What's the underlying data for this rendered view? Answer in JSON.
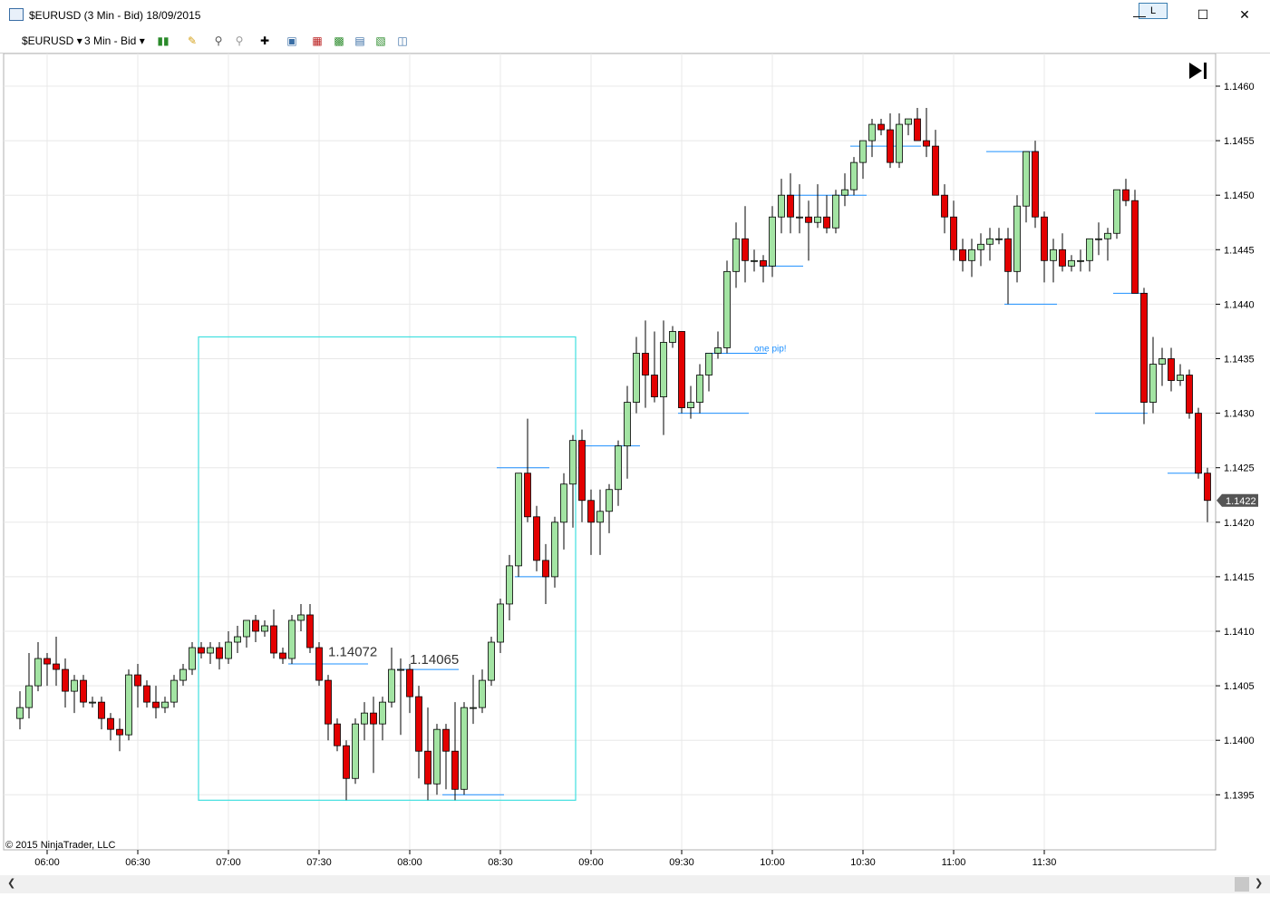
{
  "window": {
    "title": "$EURUSD (3 Min - Bid)  18/09/2015",
    "layout_button": "L",
    "minimize_icon": "minimize-icon",
    "maximize_icon": "maximize-icon",
    "close_icon": "close-icon"
  },
  "toolbar": {
    "instrument": "$EURUSD",
    "interval": "3 Min - Bid",
    "icons": [
      "chart-style-icon",
      "drawing-tool-icon",
      "zoom-in-icon",
      "zoom-out-icon",
      "crosshair-icon",
      "properties-icon",
      "strategies-icon",
      "indicators-icon",
      "chart-trader-icon",
      "data-box-icon",
      "panel-icon"
    ]
  },
  "colors": {
    "up": "#a3e4a3",
    "down": "#e30000",
    "level": "#1e90ff",
    "box": "#40e0e0",
    "grid": "#e8e8e8"
  },
  "chart_data": {
    "type": "candlestick",
    "copyright": "© 2015 NinjaTrader, LLC",
    "ylim": [
      1.1391,
      1.1462
    ],
    "y_ticks": [
      "1.1460",
      "1.1455",
      "1.1450",
      "1.1445",
      "1.1440",
      "1.1435",
      "1.1430",
      "1.1425",
      "1.1420",
      "1.1415",
      "1.1410",
      "1.1405",
      "1.1400",
      "1.1395"
    ],
    "x_ticks": [
      "06:00",
      "06:30",
      "07:00",
      "07:30",
      "08:00",
      "08:30",
      "09:00",
      "09:30",
      "10:00",
      "10:30",
      "11:00",
      "11:30"
    ],
    "start_time": "05:51",
    "bar_minutes": 3,
    "current_price": "1.1422",
    "annotations": {
      "price_label_1": "1.14072",
      "price_label_2": "1.14065",
      "note": "one pip!"
    },
    "ohlc": [
      [
        1.1402,
        1.14045,
        1.1401,
        1.1403
      ],
      [
        1.1403,
        1.1408,
        1.1402,
        1.1405
      ],
      [
        1.1405,
        1.1409,
        1.14045,
        1.14075
      ],
      [
        1.14075,
        1.1408,
        1.1405,
        1.1407
      ],
      [
        1.1407,
        1.14095,
        1.1405,
        1.14065
      ],
      [
        1.14065,
        1.14075,
        1.1403,
        1.14045
      ],
      [
        1.14045,
        1.1406,
        1.14025,
        1.14055
      ],
      [
        1.14055,
        1.1406,
        1.1403,
        1.14035
      ],
      [
        1.14035,
        1.1404,
        1.1403,
        1.14035
      ],
      [
        1.14035,
        1.1404,
        1.1401,
        1.1402
      ],
      [
        1.1402,
        1.14025,
        1.14,
        1.1401
      ],
      [
        1.1401,
        1.1402,
        1.1399,
        1.14005
      ],
      [
        1.14005,
        1.14065,
        1.14,
        1.1406
      ],
      [
        1.1406,
        1.1407,
        1.1403,
        1.1405
      ],
      [
        1.1405,
        1.14055,
        1.1403,
        1.14035
      ],
      [
        1.14035,
        1.1405,
        1.1402,
        1.1403
      ],
      [
        1.1403,
        1.1404,
        1.14025,
        1.14035
      ],
      [
        1.14035,
        1.1406,
        1.1403,
        1.14055
      ],
      [
        1.14055,
        1.1407,
        1.1405,
        1.14065
      ],
      [
        1.14065,
        1.1409,
        1.1406,
        1.14085
      ],
      [
        1.14085,
        1.1409,
        1.14075,
        1.1408
      ],
      [
        1.1408,
        1.1409,
        1.1407,
        1.14085
      ],
      [
        1.14085,
        1.1409,
        1.14065,
        1.14075
      ],
      [
        1.14075,
        1.141,
        1.1407,
        1.1409
      ],
      [
        1.1409,
        1.14105,
        1.1408,
        1.14095
      ],
      [
        1.14095,
        1.1411,
        1.14085,
        1.1411
      ],
      [
        1.1411,
        1.14115,
        1.1409,
        1.141
      ],
      [
        1.141,
        1.1411,
        1.14095,
        1.14105
      ],
      [
        1.14105,
        1.1412,
        1.14075,
        1.1408
      ],
      [
        1.1408,
        1.14085,
        1.1407,
        1.14075
      ],
      [
        1.14075,
        1.14115,
        1.1407,
        1.1411
      ],
      [
        1.1411,
        1.14125,
        1.141,
        1.14115
      ],
      [
        1.14115,
        1.14125,
        1.1408,
        1.14085
      ],
      [
        1.14085,
        1.1409,
        1.1405,
        1.14055
      ],
      [
        1.14055,
        1.1406,
        1.14,
        1.14015
      ],
      [
        1.14015,
        1.1402,
        1.1399,
        1.13995
      ],
      [
        1.13995,
        1.14,
        1.13945,
        1.13965
      ],
      [
        1.13965,
        1.1402,
        1.1396,
        1.14015
      ],
      [
        1.14015,
        1.14035,
        1.14,
        1.14025
      ],
      [
        1.14025,
        1.1404,
        1.1397,
        1.14015
      ],
      [
        1.14015,
        1.1404,
        1.14,
        1.14035
      ],
      [
        1.14035,
        1.14085,
        1.1403,
        1.14065
      ],
      [
        1.14065,
        1.14075,
        1.14005,
        1.14065
      ],
      [
        1.14065,
        1.1407,
        1.14025,
        1.1404
      ],
      [
        1.1404,
        1.1405,
        1.13965,
        1.1399
      ],
      [
        1.1399,
        1.1403,
        1.13945,
        1.1396
      ],
      [
        1.1396,
        1.14015,
        1.1395,
        1.1401
      ],
      [
        1.1401,
        1.14015,
        1.13955,
        1.1399
      ],
      [
        1.1399,
        1.14035,
        1.13945,
        1.13955
      ],
      [
        1.13955,
        1.14035,
        1.1395,
        1.1403
      ],
      [
        1.1403,
        1.1406,
        1.14015,
        1.1403
      ],
      [
        1.1403,
        1.14065,
        1.14025,
        1.14055
      ],
      [
        1.14055,
        1.14095,
        1.1405,
        1.1409
      ],
      [
        1.1409,
        1.1413,
        1.1408,
        1.14125
      ],
      [
        1.14125,
        1.1417,
        1.1411,
        1.1416
      ],
      [
        1.1416,
        1.14245,
        1.1415,
        1.14245
      ],
      [
        1.14245,
        1.14295,
        1.142,
        1.14205
      ],
      [
        1.14205,
        1.14215,
        1.14155,
        1.14165
      ],
      [
        1.14165,
        1.1418,
        1.14125,
        1.1415
      ],
      [
        1.1415,
        1.14205,
        1.1414,
        1.142
      ],
      [
        1.142,
        1.14245,
        1.14175,
        1.14235
      ],
      [
        1.14235,
        1.1428,
        1.14195,
        1.14275
      ],
      [
        1.14275,
        1.14285,
        1.142,
        1.1422
      ],
      [
        1.1422,
        1.1423,
        1.1417,
        1.142
      ],
      [
        1.142,
        1.1423,
        1.1417,
        1.1421
      ],
      [
        1.1421,
        1.14235,
        1.1419,
        1.1423
      ],
      [
        1.1423,
        1.14275,
        1.14215,
        1.1427
      ],
      [
        1.1427,
        1.14325,
        1.1424,
        1.1431
      ],
      [
        1.1431,
        1.1437,
        1.143,
        1.14355
      ],
      [
        1.14355,
        1.14385,
        1.14305,
        1.14335
      ],
      [
        1.14335,
        1.14375,
        1.1431,
        1.14315
      ],
      [
        1.14315,
        1.14385,
        1.1428,
        1.14365
      ],
      [
        1.14365,
        1.1438,
        1.1436,
        1.14375
      ],
      [
        1.14375,
        1.14375,
        1.143,
        1.14305
      ],
      [
        1.14305,
        1.14325,
        1.14295,
        1.1431
      ],
      [
        1.1431,
        1.14345,
        1.143,
        1.14335
      ],
      [
        1.14335,
        1.14355,
        1.1432,
        1.14355
      ],
      [
        1.14355,
        1.14375,
        1.1435,
        1.1436
      ],
      [
        1.1436,
        1.1444,
        1.14355,
        1.1443
      ],
      [
        1.1443,
        1.14475,
        1.14415,
        1.1446
      ],
      [
        1.1446,
        1.1449,
        1.1442,
        1.1444
      ],
      [
        1.1444,
        1.1445,
        1.1443,
        1.1444
      ],
      [
        1.1444,
        1.14445,
        1.1442,
        1.14435
      ],
      [
        1.14435,
        1.1449,
        1.14425,
        1.1448
      ],
      [
        1.1448,
        1.14515,
        1.14465,
        1.145
      ],
      [
        1.145,
        1.1452,
        1.14465,
        1.1448
      ],
      [
        1.1448,
        1.1451,
        1.14465,
        1.1448
      ],
      [
        1.1448,
        1.14495,
        1.1444,
        1.14475
      ],
      [
        1.14475,
        1.1451,
        1.1447,
        1.1448
      ],
      [
        1.1448,
        1.145,
        1.14465,
        1.1447
      ],
      [
        1.1447,
        1.14505,
        1.14465,
        1.145
      ],
      [
        1.145,
        1.1452,
        1.1449,
        1.14505
      ],
      [
        1.14505,
        1.14535,
        1.145,
        1.1453
      ],
      [
        1.1453,
        1.1455,
        1.14515,
        1.1455
      ],
      [
        1.1455,
        1.1457,
        1.14535,
        1.14565
      ],
      [
        1.14565,
        1.1457,
        1.14555,
        1.1456
      ],
      [
        1.1456,
        1.14575,
        1.14525,
        1.1453
      ],
      [
        1.1453,
        1.14575,
        1.14525,
        1.14565
      ],
      [
        1.14565,
        1.1457,
        1.14555,
        1.1457
      ],
      [
        1.1457,
        1.1458,
        1.1455,
        1.1455
      ],
      [
        1.1455,
        1.1458,
        1.14535,
        1.14545
      ],
      [
        1.14545,
        1.1456,
        1.145,
        1.145
      ],
      [
        1.145,
        1.1451,
        1.14465,
        1.1448
      ],
      [
        1.1448,
        1.14495,
        1.1444,
        1.1445
      ],
      [
        1.1445,
        1.1446,
        1.1443,
        1.1444
      ],
      [
        1.1444,
        1.1446,
        1.14425,
        1.1445
      ],
      [
        1.1445,
        1.14465,
        1.14435,
        1.14455
      ],
      [
        1.14455,
        1.1447,
        1.1444,
        1.1446
      ],
      [
        1.1446,
        1.1447,
        1.14455,
        1.1446
      ],
      [
        1.1446,
        1.1447,
        1.144,
        1.1443
      ],
      [
        1.1443,
        1.145,
        1.1442,
        1.1449
      ],
      [
        1.1449,
        1.1454,
        1.14475,
        1.1454
      ],
      [
        1.1454,
        1.1455,
        1.1447,
        1.1448
      ],
      [
        1.1448,
        1.14485,
        1.1442,
        1.1444
      ],
      [
        1.1444,
        1.1446,
        1.1442,
        1.1445
      ],
      [
        1.1445,
        1.14465,
        1.1443,
        1.14435
      ],
      [
        1.14435,
        1.14445,
        1.1443,
        1.1444
      ],
      [
        1.1444,
        1.1445,
        1.1443,
        1.1444
      ],
      [
        1.1444,
        1.1446,
        1.1443,
        1.1446
      ],
      [
        1.1446,
        1.14475,
        1.14445,
        1.1446
      ],
      [
        1.1446,
        1.1447,
        1.1444,
        1.14465
      ],
      [
        1.14465,
        1.14505,
        1.1446,
        1.14505
      ],
      [
        1.14505,
        1.14515,
        1.1449,
        1.14495
      ],
      [
        1.14495,
        1.14505,
        1.1441,
        1.1441
      ],
      [
        1.1441,
        1.14415,
        1.1429,
        1.1431
      ],
      [
        1.1431,
        1.1437,
        1.143,
        1.14345
      ],
      [
        1.14345,
        1.1436,
        1.14325,
        1.1435
      ],
      [
        1.1435,
        1.1436,
        1.1432,
        1.1433
      ],
      [
        1.1433,
        1.14345,
        1.14325,
        1.14335
      ],
      [
        1.14335,
        1.1434,
        1.14295,
        1.143
      ],
      [
        1.143,
        1.14305,
        1.1424,
        1.14245
      ],
      [
        1.14245,
        1.1425,
        1.142,
        1.1422
      ]
    ],
    "horizontal_levels": [
      [
        1.1407,
        30,
        38
      ],
      [
        1.14065,
        42,
        48
      ],
      [
        1.1395,
        47,
        53
      ],
      [
        1.1415,
        55,
        58
      ],
      [
        1.1427,
        62,
        68
      ],
      [
        1.143,
        73,
        80
      ],
      [
        1.14355,
        76,
        82
      ],
      [
        1.14435,
        82,
        86
      ],
      [
        1.145,
        85,
        93
      ],
      [
        1.14545,
        92,
        99
      ],
      [
        1.1454,
        107,
        112
      ],
      [
        1.144,
        109,
        114
      ],
      [
        1.1441,
        121,
        124
      ],
      [
        1.143,
        119,
        124
      ],
      [
        1.14245,
        127,
        130
      ],
      [
        1.1425,
        53,
        58
      ]
    ],
    "highlight_box": {
      "from_bar": 20,
      "to_bar": 61,
      "low": 1.13945,
      "high": 1.1437
    }
  }
}
